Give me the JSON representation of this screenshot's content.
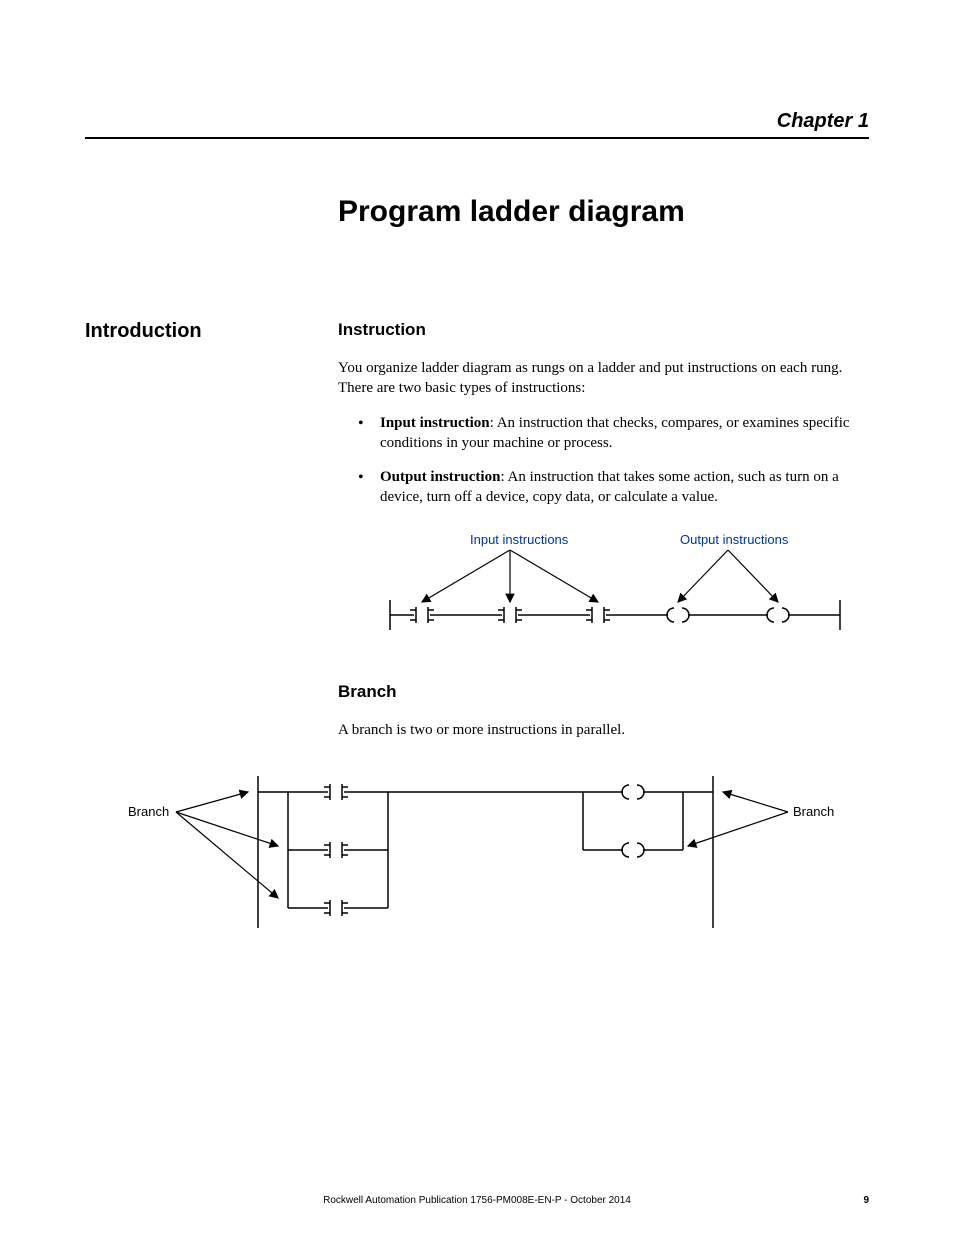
{
  "chapter_label": "Chapter 1",
  "main_title": "Program ladder diagram",
  "left_headings": {
    "introduction": "Introduction"
  },
  "instruction": {
    "heading": "Instruction",
    "intro_para": "You organize ladder diagram as rungs on a ladder and put instructions on each rung. There are two basic types of instructions:",
    "input_label": "Input instruction",
    "input_text": ": An instruction that checks, compares, or examines specific conditions in your machine or process.",
    "output_label": "Output instruction",
    "output_text": ": An instruction that takes some action, such as turn on a device, turn off a device, copy data, or calculate a value."
  },
  "diagram1": {
    "input_label": "Input instructions",
    "output_label": "Output instructions"
  },
  "branch": {
    "heading": "Branch",
    "para": "A branch is two or more instructions in parallel."
  },
  "diagram2": {
    "left_label": "Branch",
    "right_label": "Branch"
  },
  "footer": {
    "center": "Rockwell Automation Publication 1756-PM008E-EN-P - October 2014",
    "page": "9"
  }
}
